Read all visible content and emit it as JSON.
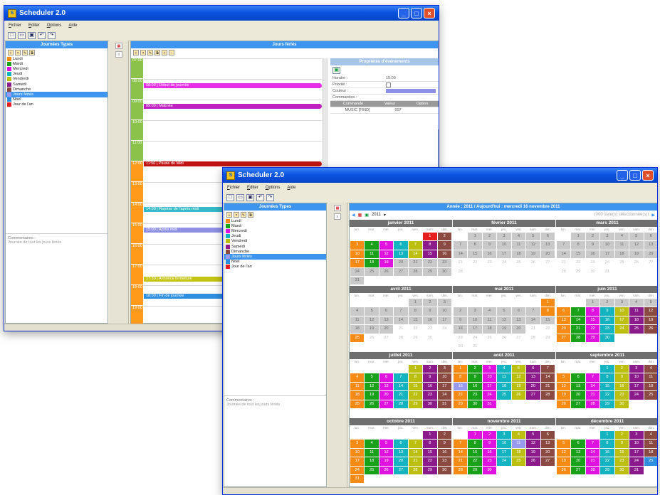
{
  "app_title": "Scheduler 2.0",
  "menu": [
    "Fichier",
    "Editer",
    "Options",
    "Aide"
  ],
  "toolbar_icons": [
    "new-icon",
    "open-icon",
    "save-icon",
    "undo-icon",
    "redo-icon"
  ],
  "panels": {
    "journees_types": "Journées Types",
    "jours_feries": "Jours fériés",
    "proprietes": "Propriétés d'événements"
  },
  "day_types": [
    {
      "label": "Lundi",
      "color": "#f58a14"
    },
    {
      "label": "Mardi",
      "color": "#1aa11a"
    },
    {
      "label": "Mercredi",
      "color": "#e012e0"
    },
    {
      "label": "Jeudi",
      "color": "#13b3bf"
    },
    {
      "label": "Vendredi",
      "color": "#bcbf0f"
    },
    {
      "label": "Samedi",
      "color": "#8b1a8b"
    },
    {
      "label": "Dimanche",
      "color": "#8a4a42"
    },
    {
      "label": "Jours fériés",
      "color": "#9999ee",
      "selected": true
    },
    {
      "label": "Noel",
      "color": "#2e8ee0"
    },
    {
      "label": "Jour de l'an",
      "color": "#e61e1e"
    }
  ],
  "comments": {
    "label": "Commentaires :",
    "value_back": "Journée de tout les jours fériés",
    "value_front": "Journée de tout les jours fériés"
  },
  "timeline": {
    "hours": [
      "07:00",
      "08:00",
      "09:00",
      "10:00",
      "11:00",
      "12:00",
      "13:00",
      "14:00",
      "15:00",
      "16:00",
      "17:00",
      "18:00",
      "19:00"
    ],
    "hour_colors": [
      "#8bc34a",
      "#8bc34a",
      "#8bc34a",
      "#8bc34a",
      "#8bc34a",
      "#ff9a1a",
      "#ff9a1a",
      "#ff9a1a",
      "#ff9a1a",
      "#ff9a1a",
      "#ff9a1a",
      "#ff9a1a",
      "#ff9a1a"
    ],
    "events": [
      {
        "label": "08:00 | Début de journée",
        "color": "#e62ee6",
        "slot": 1.2
      },
      {
        "label": "09:00 | Matinée",
        "color": "#c020c0",
        "slot": 2.2
      },
      {
        "label": "11:50 | Pause du Midi",
        "color": "#c01414",
        "slot": 5.0
      },
      {
        "label": "14:00 | Reprise de l'après midi",
        "color": "#35b8c8",
        "slot": 7.2
      },
      {
        "label": "15:00 | Après midi",
        "color": "#8f8fe6",
        "slot": 8.2
      },
      {
        "label": "17:30 | Annonce fermeture",
        "color": "#c4c414",
        "slot": 10.6
      },
      {
        "label": "18:00 | Fin de journée",
        "color": "#2e8ee0",
        "slot": 11.4
      }
    ]
  },
  "properties": {
    "rows": [
      {
        "k": "Horaire :",
        "v": "15:00"
      },
      {
        "k": "Priorité :",
        "v": ""
      },
      {
        "k": "Couleur :",
        "v": ""
      },
      {
        "k": "Commandes :",
        "v": ""
      }
    ],
    "cols": [
      "Commande",
      "Valeur",
      "Option"
    ],
    "cmd": [
      "MUSIC [FIND]",
      "007",
      ""
    ]
  },
  "calendar": {
    "header": "Année : 2011 / Aujourd'hui : mercredi 16 novembre 2011",
    "year": "2011",
    "selection": "(000 date(s) sélectionnée(s))",
    "weekdays": [
      "lun.",
      "mar.",
      "mer.",
      "jeu.",
      "ven.",
      "sam.",
      "dim."
    ],
    "months": [
      "janvier 2011",
      "février 2011",
      "mars 2011",
      "avril 2011",
      "mai 2011",
      "juin 2011",
      "juillet 2011",
      "août 2011",
      "septembre 2011",
      "octobre 2011",
      "novembre 2011",
      "décembre 2011"
    ],
    "offsets": [
      5,
      1,
      1,
      4,
      6,
      2,
      4,
      0,
      3,
      5,
      1,
      3
    ],
    "lengths": [
      31,
      28,
      31,
      30,
      31,
      30,
      31,
      31,
      30,
      31,
      30,
      31
    ],
    "colored_from": [
      1,
      0,
      0,
      0,
      0,
      0,
      0,
      0,
      0,
      0,
      0,
      0
    ],
    "colored_ranges": [
      [
        1,
        19
      ],
      [
        0,
        0
      ],
      [
        0,
        0
      ],
      [
        0,
        0
      ],
      [
        0,
        0
      ],
      [
        6,
        30
      ],
      [
        1,
        31
      ],
      [
        1,
        31
      ],
      [
        1,
        30
      ],
      [
        1,
        31
      ],
      [
        1,
        30
      ],
      [
        1,
        31
      ]
    ],
    "holidays": {
      "0-1": "#e61e1e",
      "3-25": "#f58a14",
      "4-1": "#f58a14",
      "4-8": "#f58a14",
      "7-15": "#9999ee",
      "10-1": "#e012e0",
      "10-11": "#9999ee",
      "11-25": "#2e8ee0"
    }
  }
}
